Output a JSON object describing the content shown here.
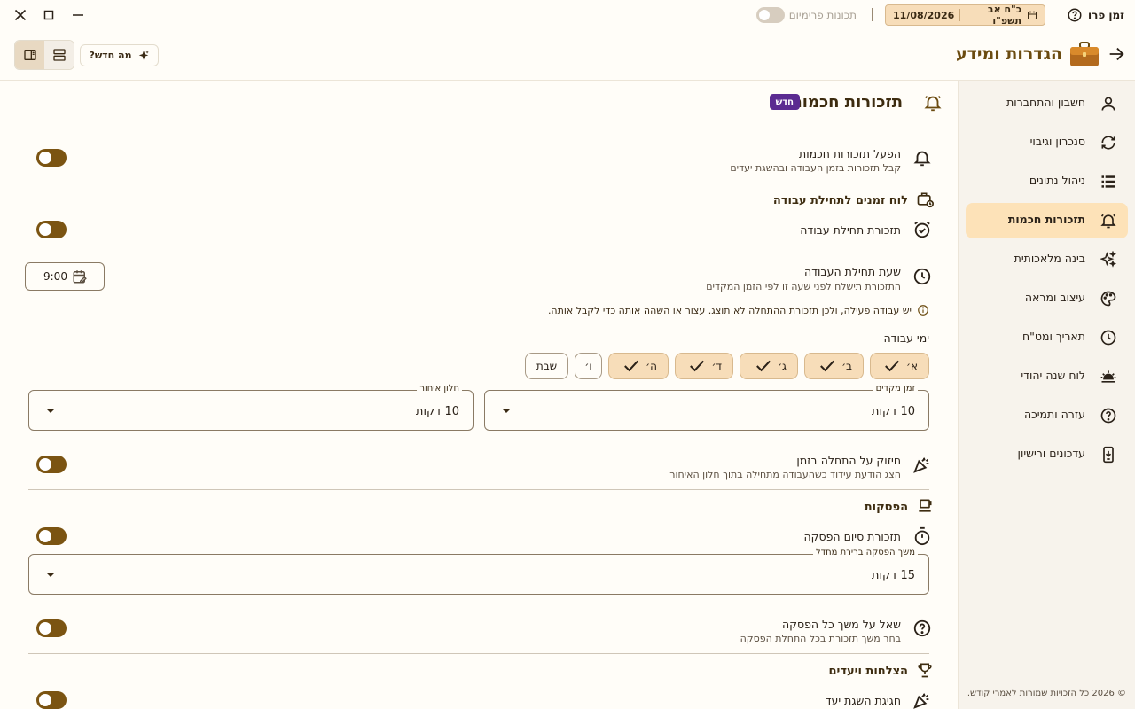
{
  "titlebar": {
    "app_name": "זמן פרו",
    "hebrew_date": "כ\"ח אב תשפ\"ו",
    "gregorian_date": "11/08/2026",
    "premium_label": "תכונות פרימיום",
    "premium_enabled": false
  },
  "header": {
    "title": "הגדרות ומידע",
    "whats_new_label": "מה חדש?"
  },
  "sidebar": {
    "items": [
      {
        "label": "חשבון והתחברות",
        "icon": "person-icon"
      },
      {
        "label": "סנכרון וגיבוי",
        "icon": "sync-icon"
      },
      {
        "label": "ניהול נתונים",
        "icon": "list-icon"
      },
      {
        "label": "תזכורות חכמות",
        "icon": "bell-icon",
        "active": true
      },
      {
        "label": "בינה מלאכותית",
        "icon": "sparkle-icon"
      },
      {
        "label": "עיצוב ומראה",
        "icon": "palette-icon"
      },
      {
        "label": "תאריך ומט\"ח",
        "icon": "clock-icon"
      },
      {
        "label": "לוח שנה יהודי",
        "icon": "sunrise-icon"
      },
      {
        "label": "עזרה ותמיכה",
        "icon": "help-icon"
      },
      {
        "label": "עדכונים ורישיון",
        "icon": "phone-download-icon"
      }
    ],
    "copyright": "© 2026 כל הזכויות שמורות לאמרי קודש."
  },
  "main": {
    "title": "תזכורות חכמות",
    "new_badge": "חדש",
    "enable": {
      "title": "הפעל תזכורות חכמות",
      "subtitle": "קבל תזכורות בזמן העבודה ובהשגת יעדים",
      "enabled": true
    },
    "schedule_heading": "לוח זמנים לתחילת עבודה",
    "start_reminder": {
      "title": "תזכורת תחילת עבודה",
      "enabled": true
    },
    "start_time": {
      "title": "שעת תחילת העבודה",
      "subtitle": "התזכורת תישלח לפני שעה זו לפי הזמן המקדים",
      "value": "9:00"
    },
    "info_text": "יש עבודה פעילה, ולכן תזכורת ההתחלה לא תוצג. עצור או השהה אותה כדי לקבל אותה.",
    "workdays_label": "ימי עבודה",
    "days": [
      {
        "label": "א׳",
        "on": true
      },
      {
        "label": "ב׳",
        "on": true
      },
      {
        "label": "ג׳",
        "on": true
      },
      {
        "label": "ד׳",
        "on": true
      },
      {
        "label": "ה׳",
        "on": true
      },
      {
        "label": "ו׳",
        "on": false
      },
      {
        "label": "שבת",
        "on": false
      }
    ],
    "advance_time": {
      "legend": "זמן מקדים",
      "value": "10 דקות"
    },
    "late_window": {
      "legend": "חלון איחור",
      "value": "10 דקות"
    },
    "on_time": {
      "title": "חיזוק על התחלה בזמן",
      "subtitle": "הצג הודעת עידוד כשהעבודה מתחילה בתוך חלון האיחור",
      "enabled": true
    },
    "breaks_heading": "הפסקות",
    "break_end": {
      "title": "תזכורת סיום הפסקה",
      "enabled": true
    },
    "break_duration": {
      "legend": "משך הפסקה ברירת מחדל",
      "value": "15 דקות"
    },
    "ask_duration": {
      "title": "שאל על משך כל הפסקה",
      "subtitle": "בחר משך תזכורת בכל התחלת הפסקה",
      "enabled": true
    },
    "achievements_heading": "הצלחות ויעדים",
    "goal_celebration": {
      "title": "חגיגת השגת יעד",
      "enabled": true
    }
  },
  "colors": {
    "accent": "#7b5412",
    "active_bg": "#fde2b8",
    "badge": "#5b2b91"
  }
}
